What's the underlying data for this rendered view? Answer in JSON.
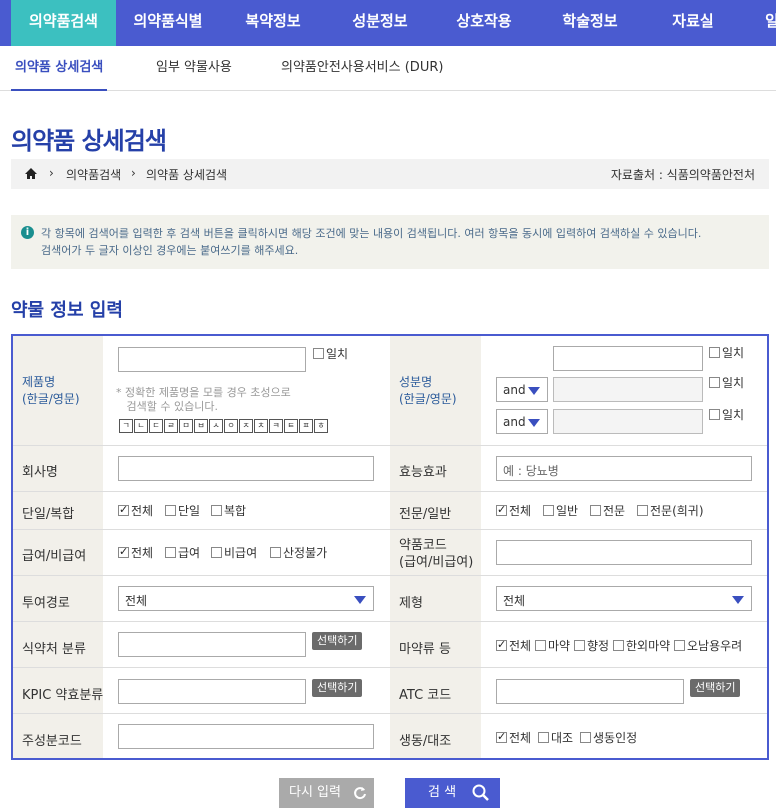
{
  "topnav": [
    "의약품검색",
    "의약품식별",
    "복약정보",
    "성분정보",
    "상호작용",
    "학술정보",
    "자료실",
    "일"
  ],
  "subnav": [
    "의약품 상세검색",
    "임부 약물사용",
    "의약품안전사용서비스 (DUR)"
  ],
  "page_title": "의약품 상세검색",
  "breadcrumb": {
    "items": [
      "의약품검색",
      "의약품 상세검색"
    ],
    "source": "자료출처 : 식품의약품안전처"
  },
  "info": {
    "line1": "각 항목에 검색어를 입력한 후 검색 버튼을 클릭하시면 해당 조건에 맞는 내용이 검색됩니다. 여러 항목을 동시에 입력하여 검색하실 수 있습니다.",
    "line2": "검색어가 두 글자 이상인 경우에는 붙여쓰기를 해주세요."
  },
  "section_title": "약물 정보 입력",
  "labels": {
    "product": "제품명",
    "product_sub": "(한글/영문)",
    "ingredient": "성분명",
    "ingredient_sub": "(한글/영문)",
    "company": "회사명",
    "efficacy": "효능효과",
    "single": "단일/복합",
    "pro": "전문/일반",
    "insurance": "급여/비급여",
    "drugcode": "약품코드",
    "drugcode_sub": "(급여/비급여)",
    "route": "투여경로",
    "form": "제형",
    "mfds_class": "식약처 분류",
    "narcotic": "마약류 등",
    "kpic": "KPIC 약효분류",
    "atc": "ATC 코드",
    "main_code": "주성분코드",
    "biosim": "생동/대조"
  },
  "exact": "일치",
  "product_note": "* 정확한 제품명을 모를 경우 초성으로\n   검색할 수 있습니다.",
  "consonants": [
    "ㄱ",
    "ㄴ",
    "ㄷ",
    "ㄹ",
    "ㅁ",
    "ㅂ",
    "ㅅ",
    "ㅇ",
    "ㅈ",
    "ㅊ",
    "ㅋ",
    "ㅌ",
    "ㅍ",
    "ㅎ"
  ],
  "and_label": "and",
  "efficacy_placeholder": "예 : 당뇨병",
  "single_opts": [
    "전체",
    "단일",
    "복합"
  ],
  "pro_opts": [
    "전체",
    "일반",
    "전문",
    "전문(희귀)"
  ],
  "ins_opts": [
    "전체",
    "급여",
    "비급여",
    "산정불가"
  ],
  "route_value": "전체",
  "form_value": "전체",
  "select_btn": "선택하기",
  "narc_opts": [
    "전체",
    "마약",
    "향정",
    "한외마약",
    "오남용우려"
  ],
  "bio_opts": [
    "전체",
    "대조",
    "생동인정"
  ],
  "reset_btn": "다시 입력",
  "search_btn": "검 색",
  "colors": {
    "nav": "#4a5bd0",
    "active_tab": "#3cc0c0",
    "title": "#2540a8"
  }
}
